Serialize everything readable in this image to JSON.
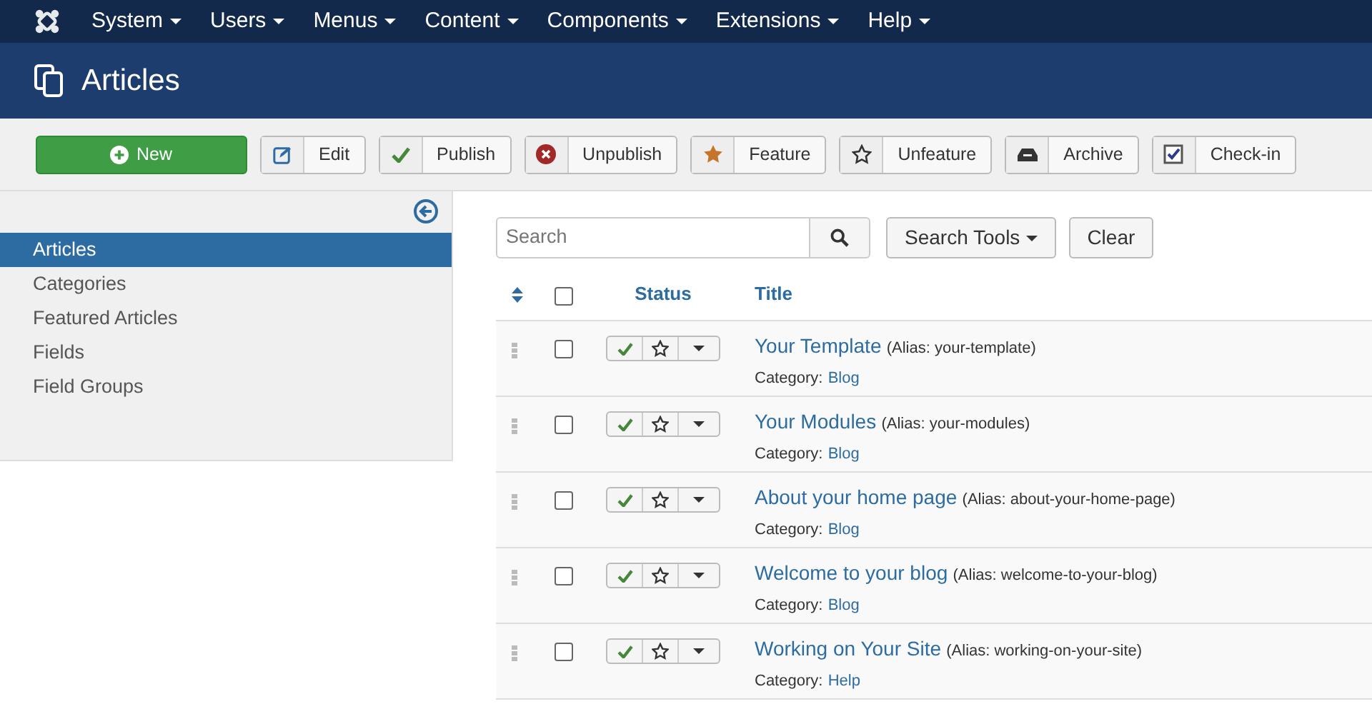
{
  "menu": [
    "System",
    "Users",
    "Menus",
    "Content",
    "Components",
    "Extensions",
    "Help"
  ],
  "header": {
    "title": "Articles"
  },
  "toolbar": [
    {
      "kind": "new",
      "label": "New"
    },
    {
      "kind": "edit",
      "label": "Edit"
    },
    {
      "kind": "publish",
      "label": "Publish"
    },
    {
      "kind": "unpublish",
      "label": "Unpublish"
    },
    {
      "kind": "feature",
      "label": "Feature"
    },
    {
      "kind": "unfeature",
      "label": "Unfeature"
    },
    {
      "kind": "archive",
      "label": "Archive"
    },
    {
      "kind": "checkin",
      "label": "Check-in"
    }
  ],
  "sidebar": {
    "items": [
      {
        "label": "Articles",
        "selected": true
      },
      {
        "label": "Categories",
        "selected": false
      },
      {
        "label": "Featured Articles",
        "selected": false
      },
      {
        "label": "Fields",
        "selected": false
      },
      {
        "label": "Field Groups",
        "selected": false
      }
    ]
  },
  "filters": {
    "search": {
      "placeholder": "Search"
    },
    "search_tools": "Search Tools",
    "clear": "Clear"
  },
  "table": {
    "columns": [
      "Status",
      "Title"
    ],
    "select_all": {
      "checked": false
    },
    "rows": [
      {
        "title": "Your Template",
        "alias": "(Alias: your-template)",
        "category_label": "Category:",
        "category": "Blog",
        "checked": false,
        "published": true,
        "featured": false
      },
      {
        "title": "Your Modules",
        "alias": "(Alias: your-modules)",
        "category_label": "Category:",
        "category": "Blog",
        "checked": false,
        "published": true,
        "featured": false
      },
      {
        "title": "About your home page",
        "alias": "(Alias: about-your-home-page)",
        "category_label": "Category:",
        "category": "Blog",
        "checked": false,
        "published": true,
        "featured": false
      },
      {
        "title": "Welcome to your blog",
        "alias": "(Alias: welcome-to-your-blog)",
        "category_label": "Category:",
        "category": "Blog",
        "checked": false,
        "published": true,
        "featured": false
      },
      {
        "title": "Working on Your Site",
        "alias": "(Alias: working-on-your-site)",
        "category_label": "Category:",
        "category": "Help",
        "checked": false,
        "published": true,
        "featured": false
      }
    ]
  }
}
